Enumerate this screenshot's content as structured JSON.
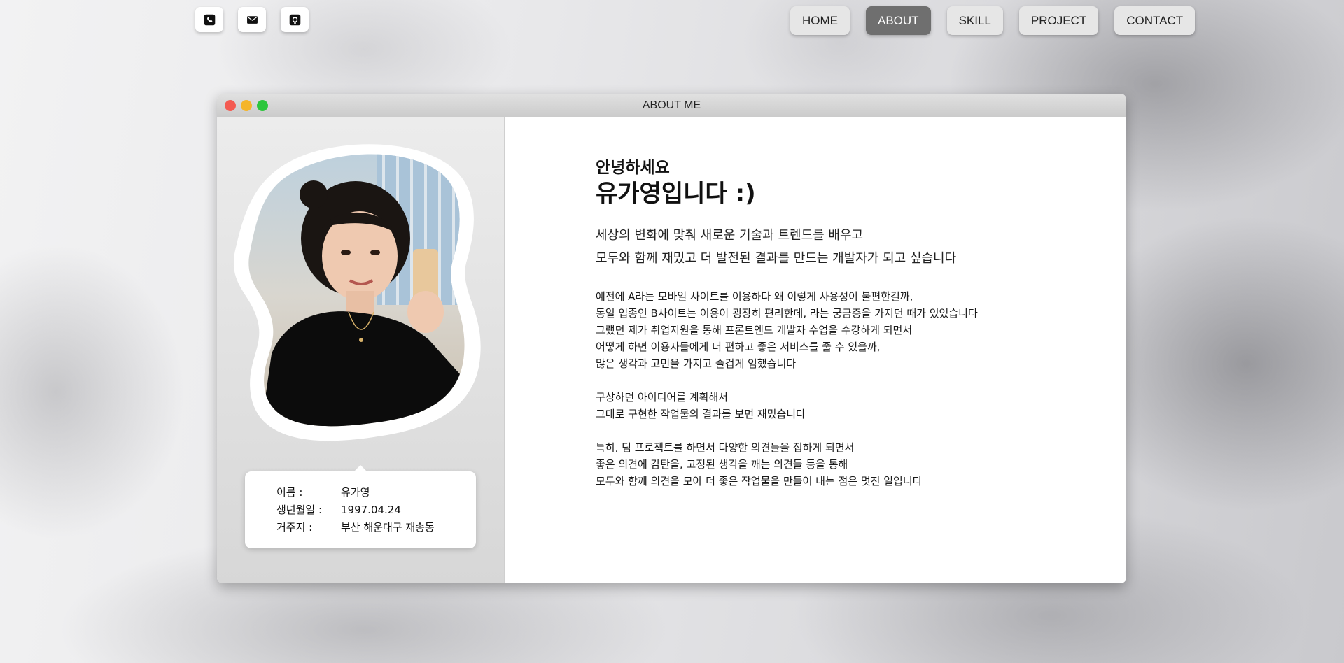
{
  "social": [
    {
      "name": "phone-icon"
    },
    {
      "name": "mail-icon"
    },
    {
      "name": "github-icon"
    }
  ],
  "nav": {
    "items": [
      "HOME",
      "ABOUT",
      "SKILL",
      "PROJECT",
      "CONTACT"
    ],
    "active": "ABOUT"
  },
  "window": {
    "title": "ABOUT ME"
  },
  "profile": {
    "name_label": "이름 :",
    "name_value": "유가영",
    "birth_label": "생년월일 :",
    "birth_value": "1997.04.24",
    "home_label": "거주지 :",
    "home_value": "부산 해운대구 재송동"
  },
  "intro": {
    "greeting": "안녕하세요",
    "name_line": "유가영입니다 :)",
    "motto": [
      "세상의 변화에 맞춰 새로운 기술과 트렌드를 배우고",
      "모두와 함께 재밌고 더 발전된 결과를 만드는 개발자가 되고 싶습니다"
    ],
    "para1": [
      "예전에 A라는 모바일 사이트를 이용하다 왜 이렇게 사용성이 불편한걸까,",
      "동일 업종인 B사이트는 이용이 굉장히 편리한데, 라는 궁금증을 가지던 때가 있었습니다",
      "그랬던 제가 취업지원을 통해 프론트엔드 개발자 수업을 수강하게 되면서",
      "어떻게 하면 이용자들에게 더 편하고 좋은 서비스를 줄 수 있을까,",
      "많은 생각과 고민을 가지고 즐겁게 임했습니다"
    ],
    "para2": [
      "구상하던 아이디어를 계획해서",
      "그대로 구현한 작업물의 결과를 보면 재밌습니다"
    ],
    "para3": [
      "특히, 팀 프로젝트를 하면서 다양한 의견들을 접하게 되면서",
      "좋은 의견에 감탄을, 고정된 생각을 깨는 의견들 등을 통해",
      "모두와 함께 의견을 모아 더 좋은 작업물을 만들어 내는 점은 멋진 일입니다"
    ]
  },
  "colors": {
    "nav_active": "#6f6f6f",
    "nav_default": "#e6e6e6",
    "close": "#f45b52",
    "minimize": "#f5b52a",
    "maximize": "#2cc63c"
  }
}
